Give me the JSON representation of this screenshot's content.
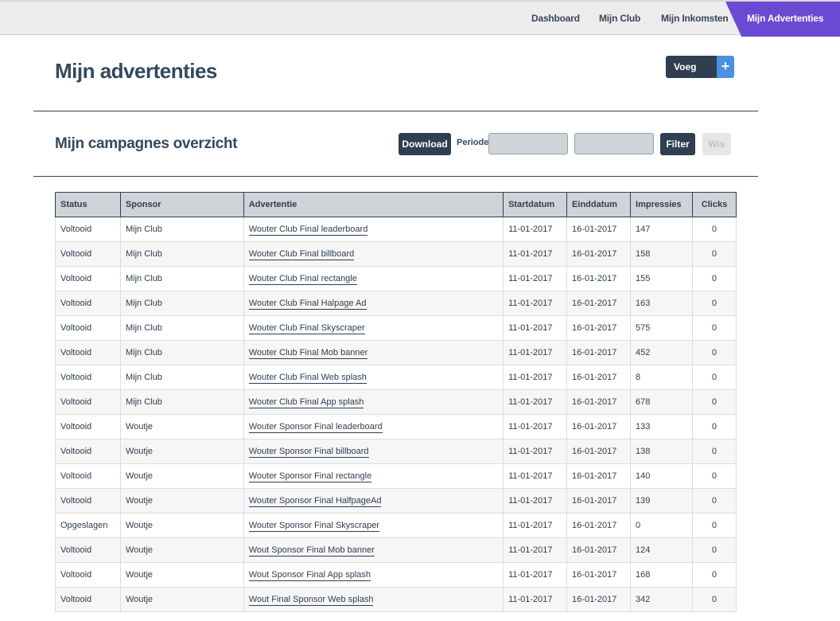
{
  "nav": {
    "items": [
      "Dashboard",
      "Mijn Club",
      "Mijn Inkomsten",
      "Mijn Advertenties"
    ]
  },
  "header": {
    "title": "Mijn advertenties",
    "add_label": "Voeg toe",
    "add_icon": "+"
  },
  "campaigns": {
    "title": "Mijn campagnes overzicht",
    "download_label": "Download",
    "periode_label": "Periode",
    "date_from": "",
    "date_to": "",
    "filter_label": "Filter",
    "wis_label": "Wis"
  },
  "table": {
    "headers": [
      "Status",
      "Sponsor",
      "Advertentie",
      "Startdatum",
      "Einddatum",
      "Impressies",
      "Clicks"
    ],
    "rows": [
      [
        "Voltooid",
        "Mijn Club",
        "Wouter Club Final leaderboard",
        "11-01-2017",
        "16-01-2017",
        "147",
        "0"
      ],
      [
        "Voltooid",
        "Mijn Club",
        "Wouter Club Final billboard",
        "11-01-2017",
        "16-01-2017",
        "158",
        "0"
      ],
      [
        "Voltooid",
        "Mijn Club",
        "Wouter Club Final rectangle",
        "11-01-2017",
        "16-01-2017",
        "155",
        "0"
      ],
      [
        "Voltooid",
        "Mijn Club",
        "Wouter Club Final Halpage Ad",
        "11-01-2017",
        "16-01-2017",
        "163",
        "0"
      ],
      [
        "Voltooid",
        "Mijn Club",
        "Wouter Club Final Skyscraper",
        "11-01-2017",
        "16-01-2017",
        "575",
        "0"
      ],
      [
        "Voltooid",
        "Mijn Club",
        "Wouter Club Final Mob banner",
        "11-01-2017",
        "16-01-2017",
        "452",
        "0"
      ],
      [
        "Voltooid",
        "Mijn Club",
        "Wouter Club Final Web splash",
        "11-01-2017",
        "16-01-2017",
        "8",
        "0"
      ],
      [
        "Voltooid",
        "Mijn Club",
        "Wouter Club Final App splash",
        "11-01-2017",
        "16-01-2017",
        "678",
        "0"
      ],
      [
        "Voltooid",
        "Woutje",
        "Wouter Sponsor Final leaderboard",
        "11-01-2017",
        "16-01-2017",
        "133",
        "0"
      ],
      [
        "Voltooid",
        "Woutje",
        "Wouter Sponsor Final billboard",
        "11-01-2017",
        "16-01-2017",
        "138",
        "0"
      ],
      [
        "Voltooid",
        "Woutje",
        "Wouter Sponsor Final rectangle",
        "11-01-2017",
        "16-01-2017",
        "140",
        "0"
      ],
      [
        "Voltooid",
        "Woutje",
        "Wouter Sponsor Final HalfpageAd",
        "11-01-2017",
        "16-01-2017",
        "139",
        "0"
      ],
      [
        "Opgeslagen",
        "Woutje",
        "Wouter Sponsor Final Skyscraper",
        "11-01-2017",
        "16-01-2017",
        "0",
        "0"
      ],
      [
        "Voltooid",
        "Woutje",
        "Wout Sponsor Final Mob banner",
        "11-01-2017",
        "16-01-2017",
        "124",
        "0"
      ],
      [
        "Voltooid",
        "Woutje",
        "Wout Sponsor Final App splash",
        "11-01-2017",
        "16-01-2017",
        "168",
        "0"
      ],
      [
        "Voltooid",
        "Woutje",
        "Wout Final Sponsor Web splash",
        "11-01-2017",
        "16-01-2017",
        "342",
        "0"
      ]
    ]
  },
  "colors": {
    "accent": "#6b4ad3",
    "dark": "#2f3e50",
    "plus_button": "#4a90e2"
  }
}
